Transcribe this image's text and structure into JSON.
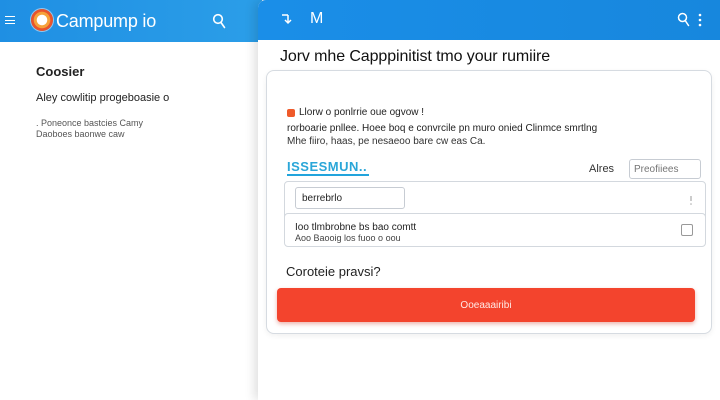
{
  "back_window": {
    "app_title": "Campump io",
    "heading": "Coosier",
    "subheading": "Aley cowlitip progeboasie o",
    "note_lines": [
      ". Poneonce bastcies Camy",
      "Daoboes baonwe caw"
    ]
  },
  "front_window": {
    "header_letter": "M",
    "title": "Jorv mhe Capppinitist tmo your rumiire",
    "notice": {
      "title": "Llorw o ponlrrie oue ogvow !",
      "line1": "rorboarie pnllee. Hoee boq e convrcile pn muro onied Clinmce smrtlng",
      "line2": "Mhe fiiro, haas, pe nesaeoo bare cw eas Ca."
    },
    "section_label": "ISSESMUN..",
    "right_label": "Alres",
    "right_input_placeholder": "Preofiiees",
    "field_value": "berrebrlo",
    "row": {
      "text": "Ioo tlmbrobne bs bao comtt",
      "note": "Aoo Baooig los fuoo o oou"
    },
    "confirm_label": "Coroteie pravsi?",
    "submit_label": "Ooeaaairibi"
  }
}
